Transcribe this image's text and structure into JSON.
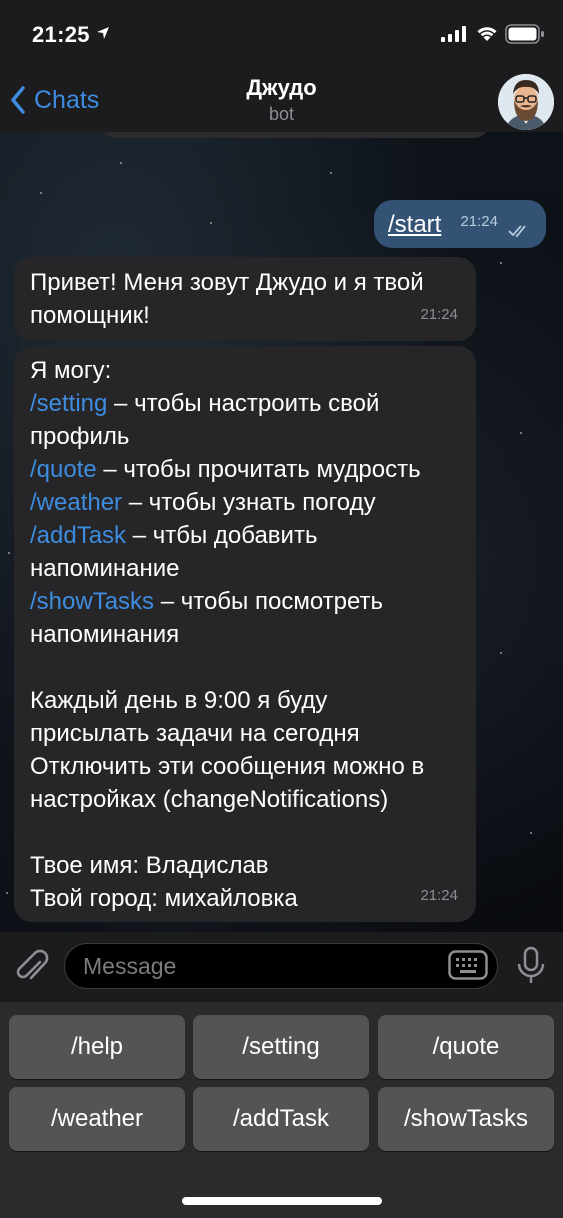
{
  "status_bar": {
    "time": "21:25"
  },
  "header": {
    "back_label": "Chats",
    "title": "Джудо",
    "subtitle": "bot"
  },
  "messages": {
    "outgoing": {
      "text": "/start",
      "time": "21:24"
    },
    "greeting": {
      "lines": [
        "Привет! Меня зовут Джудо и я твой",
        "помощник!"
      ],
      "time": "21:24"
    },
    "help": {
      "intro": "Я могу:",
      "commands": [
        {
          "cmd": "/setting",
          "desc": " – чтобы настроить свой",
          "desc2": "профиль"
        },
        {
          "cmd": "/quote",
          "desc": " – чтобы прочитать мудрость"
        },
        {
          "cmd": "/weather",
          "desc": " – чтобы узнать погоду"
        },
        {
          "cmd": "/addTask",
          "desc": " – чтбы добавить",
          "desc2": "напоминание"
        },
        {
          "cmd": "/showTasks",
          "desc": " – чтобы посмотреть",
          "desc2": "напоминания"
        }
      ],
      "daily": [
        "Каждый день в 9:00 я буду",
        "присылать задачи на сегодня",
        "Отключить эти сообщения можно в",
        "настройках (changeNotifications)"
      ],
      "profile": [
        "Твое имя: Владислав",
        "Твой город: михайловка"
      ],
      "time": "21:24"
    }
  },
  "input": {
    "placeholder": "Message"
  },
  "keyboard": {
    "row1": [
      "/help",
      "/setting",
      "/quote"
    ],
    "row2": [
      "/weather",
      "/addTask",
      "/showTasks"
    ]
  },
  "colors": {
    "accent": "#3e8ce0",
    "outgoing_bubble": "#345273",
    "incoming_bubble": "#262628"
  }
}
